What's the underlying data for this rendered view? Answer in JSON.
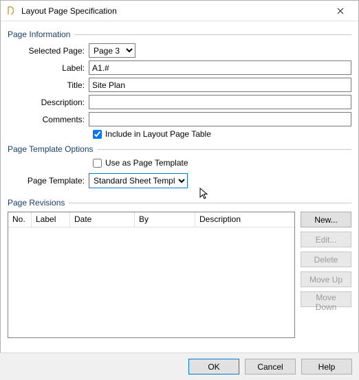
{
  "window": {
    "title": "Layout Page Specification"
  },
  "pageInfo": {
    "header": "Page Information",
    "selectedPageLabel": "Selected Page:",
    "selectedPageValue": "Page 3",
    "labelLabel": "Label:",
    "labelValue": "A1.#",
    "titleLabel": "Title:",
    "titleValue": "Site Plan",
    "descriptionLabel": "Description:",
    "descriptionValue": "",
    "commentsLabel": "Comments:",
    "commentsValue": "",
    "includeLabel": "Include in Layout Page Table",
    "includeChecked": true
  },
  "templateOpts": {
    "header": "Page Template Options",
    "useAsLabel": "Use as Page Template",
    "useAsChecked": false,
    "pageTemplateLabel": "Page Template:",
    "pageTemplateValue": "Standard Sheet Template"
  },
  "revisions": {
    "header": "Page Revisions",
    "columns": {
      "no": "No.",
      "label": "Label",
      "date": "Date",
      "by": "By",
      "desc": "Description"
    },
    "rows": [],
    "buttons": {
      "new": "New...",
      "edit": "Edit...",
      "delete": "Delete",
      "moveUp": "Move Up",
      "moveDown": "Move Down"
    }
  },
  "footer": {
    "ok": "OK",
    "cancel": "Cancel",
    "help": "Help"
  }
}
